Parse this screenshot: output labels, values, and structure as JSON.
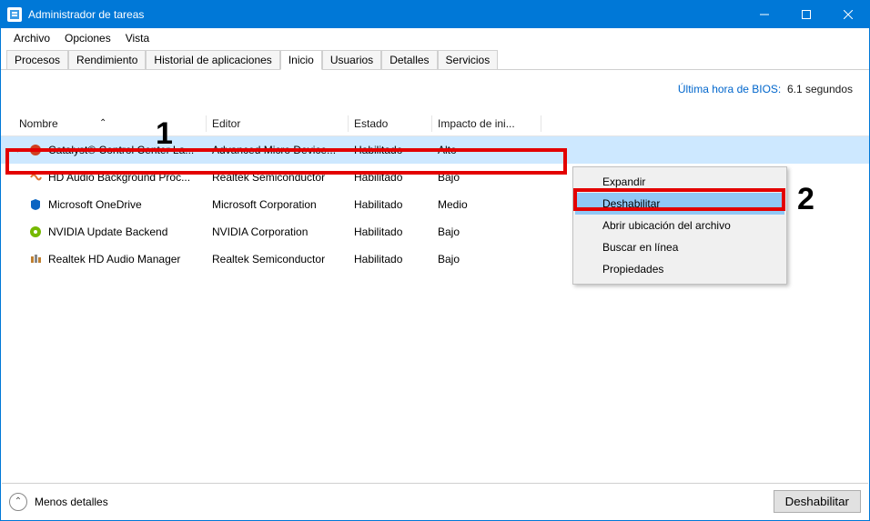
{
  "window": {
    "title": "Administrador de tareas"
  },
  "menubar": {
    "file": "Archivo",
    "options": "Opciones",
    "view": "Vista"
  },
  "tabs": {
    "processes": "Procesos",
    "performance": "Rendimiento",
    "apphistory": "Historial de aplicaciones",
    "startup": "Inicio",
    "users": "Usuarios",
    "details": "Detalles",
    "services": "Servicios"
  },
  "bios": {
    "label": "Última hora de BIOS:",
    "value": "6.1 segundos"
  },
  "columns": {
    "name": "Nombre",
    "editor": "Editor",
    "status": "Estado",
    "impact": "Impacto de ini..."
  },
  "rows": [
    {
      "name": "Catalyst® Control Center La...",
      "editor": "Advanced Micro Device...",
      "status": "Habilitado",
      "impact": "Alto"
    },
    {
      "name": "HD Audio Background Proc...",
      "editor": "Realtek Semiconductor",
      "status": "Habilitado",
      "impact": "Bajo"
    },
    {
      "name": "Microsoft OneDrive",
      "editor": "Microsoft Corporation",
      "status": "Habilitado",
      "impact": "Medio"
    },
    {
      "name": "NVIDIA Update Backend",
      "editor": "NVIDIA Corporation",
      "status": "Habilitado",
      "impact": "Bajo"
    },
    {
      "name": "Realtek HD Audio Manager",
      "editor": "Realtek Semiconductor",
      "status": "Habilitado",
      "impact": "Bajo"
    }
  ],
  "contextmenu": {
    "expand": "Expandir",
    "disable": "Deshabilitar",
    "openloc": "Abrir ubicación del archivo",
    "search": "Buscar en línea",
    "props": "Propiedades"
  },
  "statusbar": {
    "fewer": "Menos detalles",
    "disable": "Deshabilitar"
  },
  "annotations": {
    "one": "1",
    "two": "2"
  }
}
